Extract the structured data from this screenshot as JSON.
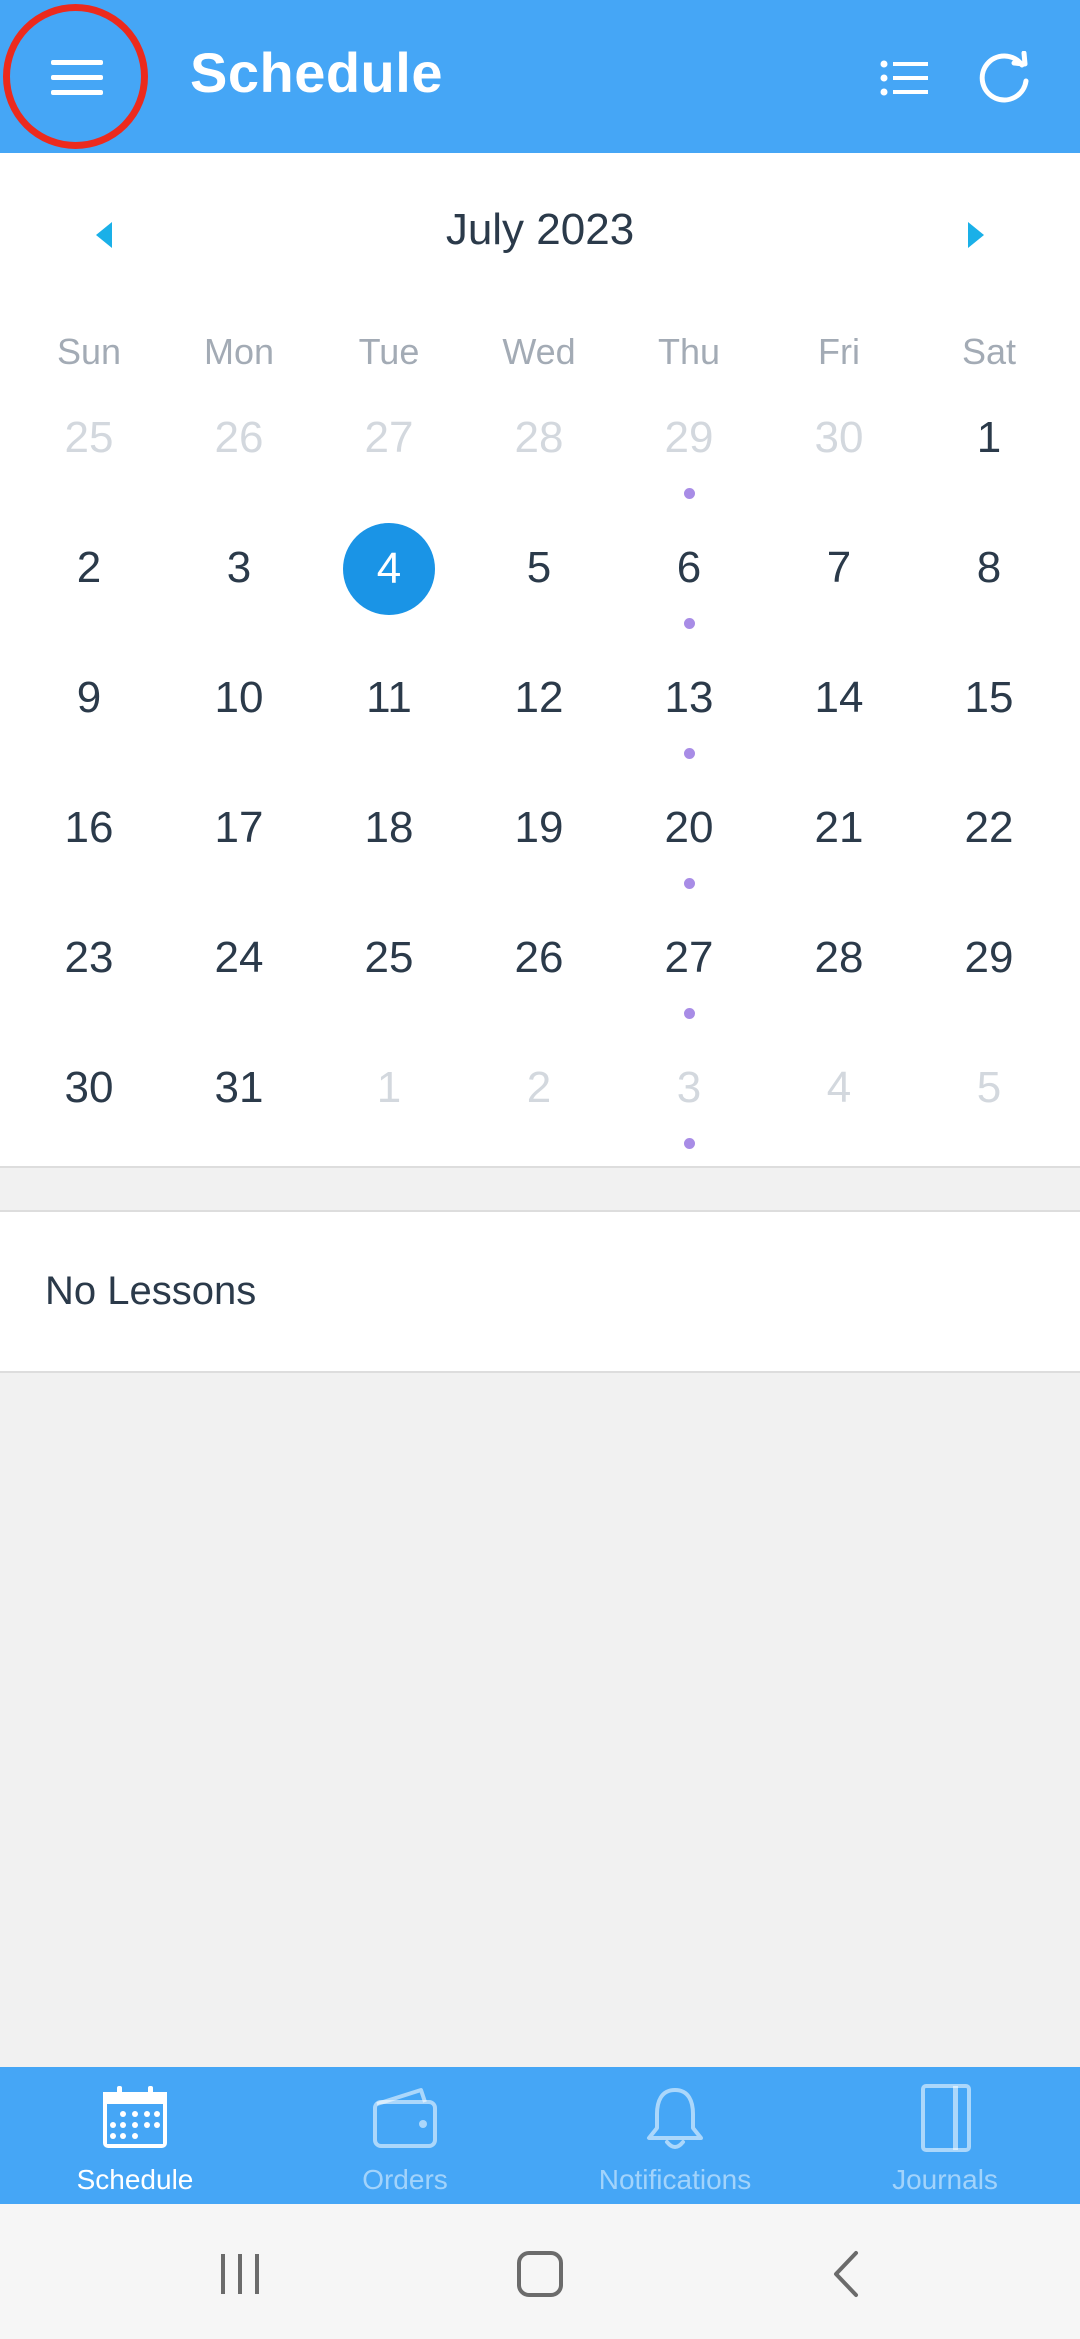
{
  "header": {
    "title": "Schedule",
    "menu_icon": "hamburger-menu-icon",
    "list_icon": "list-view-icon",
    "refresh_icon": "refresh-icon",
    "background": "#45a6f6",
    "annotation_color": "#ec2a1d"
  },
  "calendar": {
    "month_label": "July 2023",
    "weekdays": [
      "Sun",
      "Mon",
      "Tue",
      "Wed",
      "Thu",
      "Fri",
      "Sat"
    ],
    "selected_day": "4",
    "selected_color": "#1a94e6",
    "event_dot_color": "#a88ce6",
    "days": [
      {
        "label": "25",
        "current_month": false,
        "has_event": false
      },
      {
        "label": "26",
        "current_month": false,
        "has_event": false
      },
      {
        "label": "27",
        "current_month": false,
        "has_event": false
      },
      {
        "label": "28",
        "current_month": false,
        "has_event": false
      },
      {
        "label": "29",
        "current_month": false,
        "has_event": true
      },
      {
        "label": "30",
        "current_month": false,
        "has_event": false
      },
      {
        "label": "1",
        "current_month": true,
        "has_event": false
      },
      {
        "label": "2",
        "current_month": true,
        "has_event": false
      },
      {
        "label": "3",
        "current_month": true,
        "has_event": false
      },
      {
        "label": "4",
        "current_month": true,
        "has_event": false,
        "selected": true
      },
      {
        "label": "5",
        "current_month": true,
        "has_event": false
      },
      {
        "label": "6",
        "current_month": true,
        "has_event": true
      },
      {
        "label": "7",
        "current_month": true,
        "has_event": false
      },
      {
        "label": "8",
        "current_month": true,
        "has_event": false
      },
      {
        "label": "9",
        "current_month": true,
        "has_event": false
      },
      {
        "label": "10",
        "current_month": true,
        "has_event": false
      },
      {
        "label": "11",
        "current_month": true,
        "has_event": false
      },
      {
        "label": "12",
        "current_month": true,
        "has_event": false
      },
      {
        "label": "13",
        "current_month": true,
        "has_event": true
      },
      {
        "label": "14",
        "current_month": true,
        "has_event": false
      },
      {
        "label": "15",
        "current_month": true,
        "has_event": false
      },
      {
        "label": "16",
        "current_month": true,
        "has_event": false
      },
      {
        "label": "17",
        "current_month": true,
        "has_event": false
      },
      {
        "label": "18",
        "current_month": true,
        "has_event": false
      },
      {
        "label": "19",
        "current_month": true,
        "has_event": false
      },
      {
        "label": "20",
        "current_month": true,
        "has_event": true
      },
      {
        "label": "21",
        "current_month": true,
        "has_event": false
      },
      {
        "label": "22",
        "current_month": true,
        "has_event": false
      },
      {
        "label": "23",
        "current_month": true,
        "has_event": false
      },
      {
        "label": "24",
        "current_month": true,
        "has_event": false
      },
      {
        "label": "25",
        "current_month": true,
        "has_event": false
      },
      {
        "label": "26",
        "current_month": true,
        "has_event": false
      },
      {
        "label": "27",
        "current_month": true,
        "has_event": true
      },
      {
        "label": "28",
        "current_month": true,
        "has_event": false
      },
      {
        "label": "29",
        "current_month": true,
        "has_event": false
      },
      {
        "label": "30",
        "current_month": true,
        "has_event": false
      },
      {
        "label": "31",
        "current_month": true,
        "has_event": false
      },
      {
        "label": "1",
        "current_month": false,
        "has_event": false
      },
      {
        "label": "2",
        "current_month": false,
        "has_event": false
      },
      {
        "label": "3",
        "current_month": false,
        "has_event": true
      },
      {
        "label": "4",
        "current_month": false,
        "has_event": false
      },
      {
        "label": "5",
        "current_month": false,
        "has_event": false
      }
    ]
  },
  "lessons": {
    "empty_text": "No Lessons"
  },
  "tabs": [
    {
      "label": "Schedule",
      "icon": "calendar-icon",
      "active": true
    },
    {
      "label": "Orders",
      "icon": "wallet-icon",
      "active": false
    },
    {
      "label": "Notifications",
      "icon": "bell-icon",
      "active": false
    },
    {
      "label": "Journals",
      "icon": "journal-icon",
      "active": false
    }
  ],
  "system_nav": {
    "recents_icon": "recent-apps-icon",
    "home_icon": "home-icon",
    "back_icon": "back-icon"
  }
}
